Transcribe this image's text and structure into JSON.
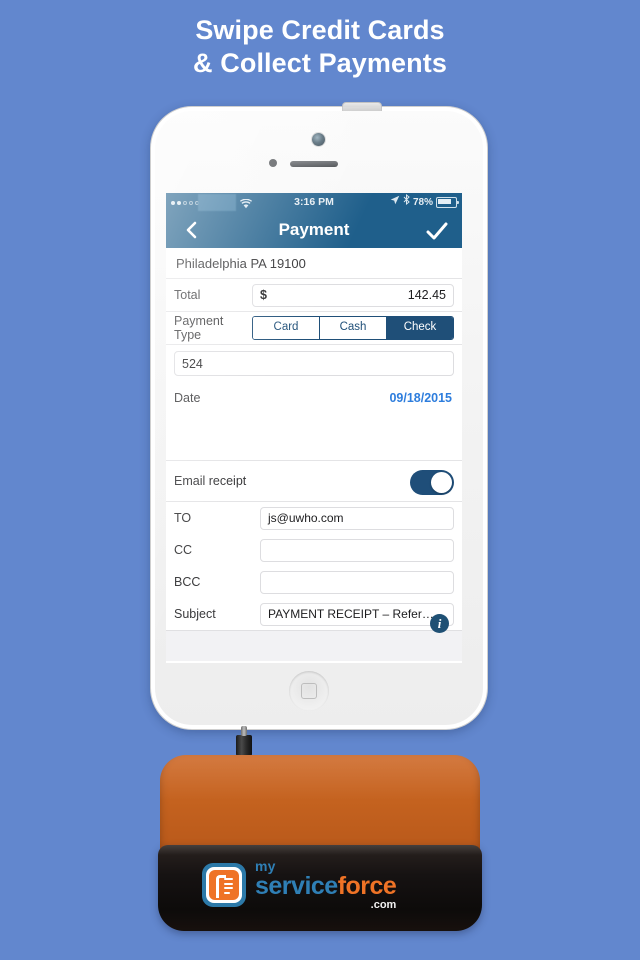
{
  "headline": {
    "line1": "Swipe Credit Cards",
    "line2": "& Collect Payments"
  },
  "colors": {
    "background": "#6287ce",
    "navbar": "#1f5f8b",
    "accent_blue": "#1f4f78",
    "link_blue": "#2d7ddd",
    "stand_orange": "#c4621f",
    "stand_black": "#141110",
    "logo_blue": "#2f7fb5",
    "logo_orange": "#ef7326"
  },
  "phone": {
    "status_bar": {
      "carrier": "",
      "time": "3:16 PM",
      "battery_percent": "78%",
      "icons": [
        "signal-dots-icon",
        "wifi-icon",
        "location-arrow-icon",
        "bluetooth-icon",
        "battery-icon"
      ]
    },
    "nav_bar": {
      "back_icon": "chevron-left-icon",
      "title": "Payment",
      "confirm_icon": "checkmark-icon"
    },
    "form": {
      "address": "Philadelphia PA 19100",
      "total": {
        "label": "Total",
        "currency": "$",
        "amount": "142.45"
      },
      "payment_type": {
        "label": "Payment Type",
        "options": [
          "Card",
          "Cash",
          "Check"
        ],
        "selected": "Check"
      },
      "check_number": "524",
      "date": {
        "label": "Date",
        "value": "09/18/2015"
      },
      "email_receipt": {
        "label": "Email receipt",
        "enabled": "on"
      },
      "email_fields": [
        {
          "label": "TO",
          "value": "js@uwho.com"
        },
        {
          "label": "CC",
          "value": ""
        },
        {
          "label": "BCC",
          "value": ""
        },
        {
          "label": "Subject",
          "value": "PAYMENT RECEIPT – Refer…"
        }
      ],
      "info_icon_label": "i"
    }
  },
  "stand": {
    "logo": {
      "my": "my",
      "service": "service",
      "force": "force",
      "com": ".com"
    }
  }
}
